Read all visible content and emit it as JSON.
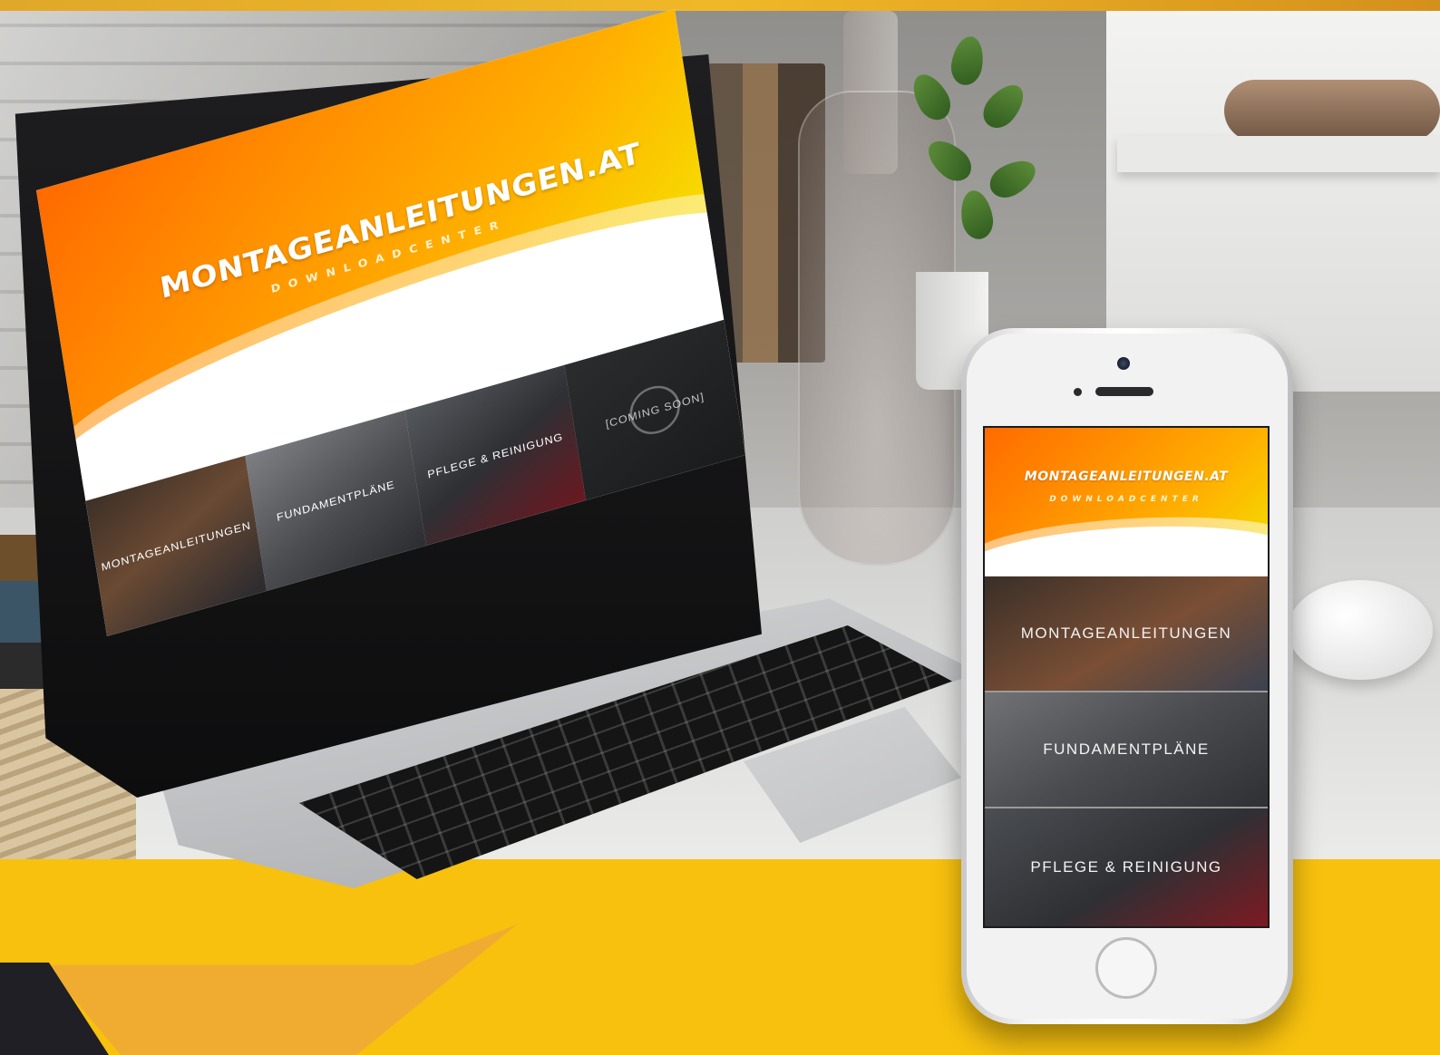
{
  "site": {
    "title": "MONTAGEANLEITUNGEN.AT",
    "subtitle": "DOWNLOADCENTER"
  },
  "laptop": {
    "tiles": [
      {
        "label": "MONTAGEANLEITUNGEN"
      },
      {
        "label": "FUNDAMENTPLÄNE"
      },
      {
        "label": "PFLEGE & REINIGUNG"
      },
      {
        "label": "[COMING SOON]"
      }
    ]
  },
  "phone": {
    "tiles": [
      {
        "label": "MONTAGEANLEITUNGEN"
      },
      {
        "label": "FUNDAMENTPLÄNE"
      },
      {
        "label": "PFLEGE & REINIGUNG"
      }
    ]
  },
  "colors": {
    "hero_start": "#ff6a00",
    "hero_end": "#f5e500",
    "band_yellow": "#f7c10e",
    "dark_corner": "#1f1f25"
  },
  "icons": {
    "coming_soon_overlay": "play-circle-icon"
  }
}
